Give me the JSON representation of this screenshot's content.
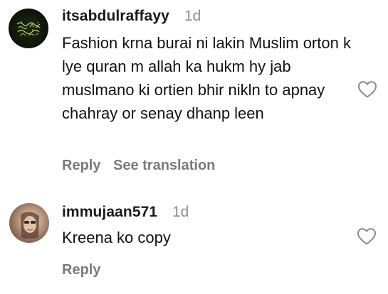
{
  "comments": [
    {
      "username": "itsabdulraffayy",
      "time": "1d",
      "text": "Fashion krna burai ni lakin Muslim orton k lye quran m allah ka hukm hy jab muslmano ki ortien bhir nikln to apnay chahray or senay dhanp leen",
      "reply_label": "Reply",
      "translate_label": "See translation",
      "avatar_icon": "calligraphy-avatar",
      "like_icon": "heart-outline-icon"
    },
    {
      "username": "immujaan571",
      "time": "1d",
      "text": "Kreena ko copy",
      "reply_label": "Reply",
      "avatar_icon": "profile-photo-avatar",
      "like_icon": "heart-outline-icon"
    }
  ],
  "colors": {
    "text": "#111111",
    "muted": "#8e8e8e",
    "action": "#7a7a7a",
    "background": "#ffffff"
  }
}
